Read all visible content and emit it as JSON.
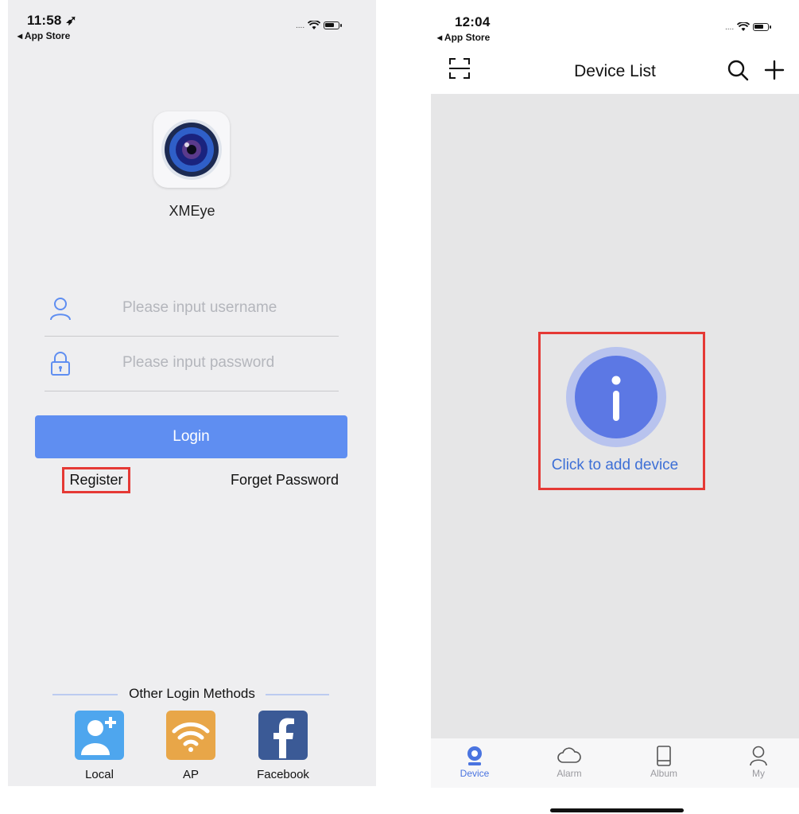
{
  "left_screen": {
    "status": {
      "time": "11:58 ➶",
      "back": "◂ App Store"
    },
    "app": {
      "name": "XMEye"
    },
    "form": {
      "username_placeholder": "Please input username",
      "password_placeholder": "Please input password",
      "login_label": "Login",
      "register_label": "Register",
      "forget_label": "Forget Password"
    },
    "other_methods": {
      "title": "Other Login Methods",
      "items": [
        {
          "label": "Local",
          "icon": "local-user-add-icon",
          "color": "#4ea6ee"
        },
        {
          "label": "AP",
          "icon": "wifi-icon",
          "color": "#e8a648"
        },
        {
          "label": "Facebook",
          "icon": "facebook-icon",
          "color": "#3b5a96"
        }
      ]
    }
  },
  "right_screen": {
    "status": {
      "time": "12:04",
      "back": "◂ App Store"
    },
    "nav": {
      "title": "Device List"
    },
    "empty_state": {
      "text": "Click to add device"
    },
    "tabs": [
      {
        "label": "Device",
        "icon": "device-icon",
        "active": true
      },
      {
        "label": "Alarm",
        "icon": "cloud-icon",
        "active": false
      },
      {
        "label": "Album",
        "icon": "album-icon",
        "active": false
      },
      {
        "label": "My",
        "icon": "person-icon",
        "active": false
      }
    ]
  },
  "colors": {
    "accent": "#5f8ef1",
    "highlight_box": "#e53935",
    "link": "#3d6fd6"
  }
}
